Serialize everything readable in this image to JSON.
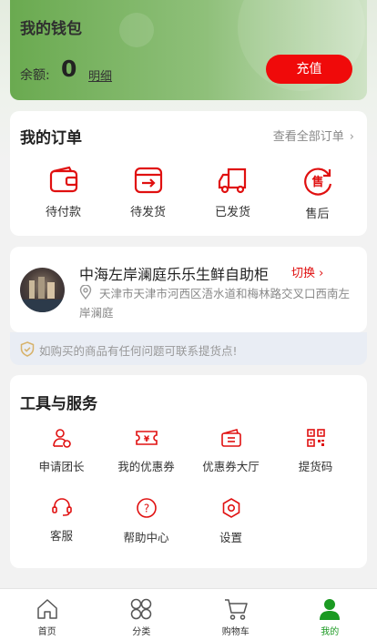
{
  "wallet": {
    "title": "我的钱包",
    "balance_label": "余额:",
    "balance_value": "0",
    "detail_link": "明细",
    "recharge_button": "充值"
  },
  "orders": {
    "title": "我的订单",
    "view_all": "查看全部订单",
    "items": [
      {
        "label": "待付款",
        "icon": "wallet-icon"
      },
      {
        "label": "待发货",
        "icon": "shipping-box-icon"
      },
      {
        "label": "已发货",
        "icon": "truck-icon"
      },
      {
        "label": "售后",
        "icon": "after-sales-icon"
      }
    ]
  },
  "store": {
    "name": "中海左岸澜庭乐乐生鲜自助柜",
    "switch_label": "切换",
    "address": "天津市天津市河西区浯水道和梅林路交叉口西南左岸澜庭"
  },
  "notice": {
    "text": "如购买的商品有任何问题可联系提货点!"
  },
  "tools": {
    "title": "工具与服务",
    "items": [
      {
        "label": "申请团长",
        "icon": "apply-leader-icon"
      },
      {
        "label": "我的优惠券",
        "icon": "coupon-icon"
      },
      {
        "label": "优惠券大厅",
        "icon": "coupon-hall-icon"
      },
      {
        "label": "提货码",
        "icon": "qr-code-icon"
      },
      {
        "label": "客服",
        "icon": "headset-icon"
      },
      {
        "label": "帮助中心",
        "icon": "help-icon"
      },
      {
        "label": "设置",
        "icon": "settings-icon"
      }
    ]
  },
  "tabbar": {
    "items": [
      {
        "label": "首页",
        "icon": "home-icon",
        "active": false
      },
      {
        "label": "分类",
        "icon": "category-icon",
        "active": false
      },
      {
        "label": "购物车",
        "icon": "cart-icon",
        "active": false
      },
      {
        "label": "我的",
        "icon": "profile-icon",
        "active": true
      }
    ]
  },
  "colors": {
    "accent_red": "#f00a0a",
    "wallet_green": "#6aaa50",
    "active_tab_green": "#1b9a22"
  }
}
